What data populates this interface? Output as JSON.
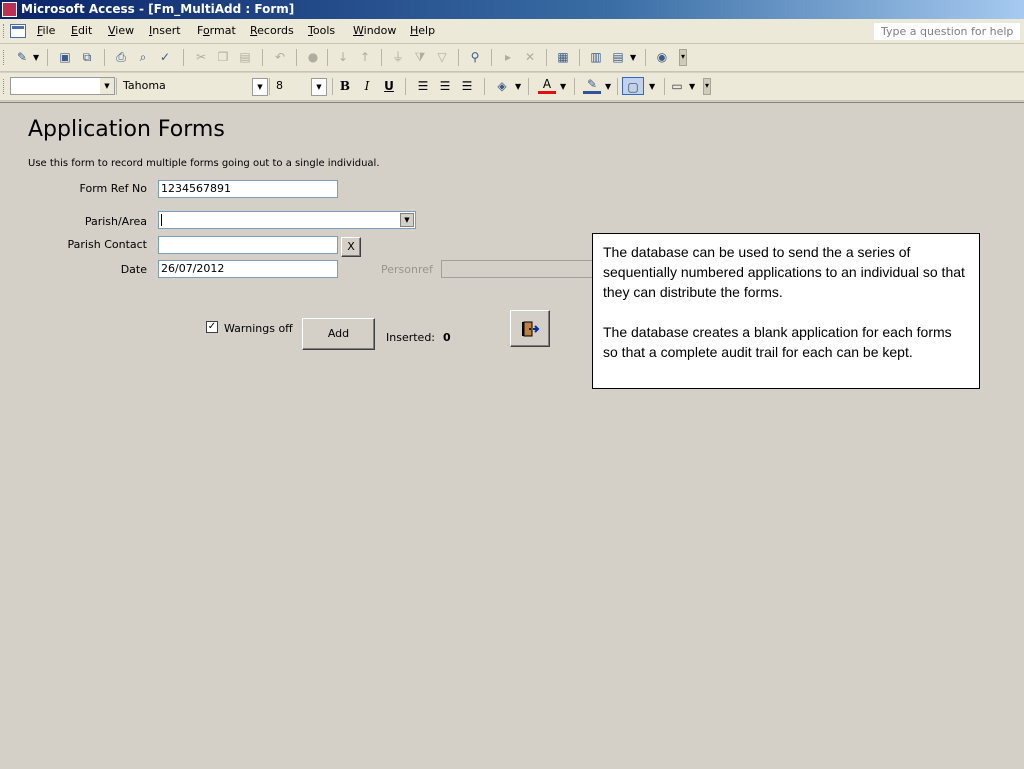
{
  "window": {
    "title": "Microsoft Access - [Fm_MultiAdd : Form]"
  },
  "menu": {
    "items": [
      {
        "label": "File",
        "u": "F",
        "rest": "ile"
      },
      {
        "label": "Edit",
        "u": "E",
        "rest": "dit"
      },
      {
        "label": "View",
        "u": "V",
        "rest": "iew"
      },
      {
        "label": "Insert",
        "u": "I",
        "rest": "nsert"
      },
      {
        "label": "Format",
        "u": "o",
        "rest": "rmat"
      },
      {
        "label": "Records",
        "u": "R",
        "rest": "ecords"
      },
      {
        "label": "Tools",
        "u": "T",
        "rest": "ools"
      },
      {
        "label": "Window",
        "u": "W",
        "rest": "indow"
      },
      {
        "label": "Help",
        "u": "H",
        "rest": "elp"
      }
    ],
    "help_placeholder": "Type a question for help"
  },
  "format_toolbar": {
    "object_combo": "",
    "font_name": "Tahoma",
    "font_size": "8",
    "bold": "B",
    "italic": "I",
    "underline": "U"
  },
  "form": {
    "title": "Application Forms",
    "description": "Use this form to record multiple forms going out to a single individual.",
    "form_ref_label": "Form Ref No",
    "form_ref_value": "1234567891",
    "parish_label": "Parish/Area",
    "parish_value": "",
    "contact_label": "Parish Contact",
    "contact_value": "",
    "clear_button": "X",
    "date_label": "Date",
    "date_value": "26/07/2012",
    "personref_label": "Personref",
    "personref_value": "",
    "warnings_label": "Warnings off",
    "warnings_checked": true,
    "add_button": "Add",
    "inserted_label": "Inserted:",
    "inserted_value": "0"
  },
  "note": {
    "paragraph1": "The database can be used to send the a series of sequentially numbered applications to an individual so that they can distribute the forms.",
    "paragraph2": "The database creates a blank application for each forms so that a complete audit trail for each can be kept."
  },
  "icons": [
    "access-app-icon",
    "form-doc-icon",
    "design-view-icon",
    "save-icon",
    "print-icon",
    "spell-check-icon",
    "cut-icon",
    "copy-icon",
    "paste-icon",
    "undo-icon",
    "sort-ascending-icon",
    "sort-descending-icon",
    "filter-icon",
    "find-icon",
    "new-record-icon",
    "delete-record-icon",
    "properties-icon",
    "database-window-icon",
    "new-object-icon",
    "help-icon",
    "fill-color-icon",
    "font-color-icon",
    "line-color-icon",
    "border-icon",
    "exit-door-icon",
    "checkmark-icon"
  ]
}
